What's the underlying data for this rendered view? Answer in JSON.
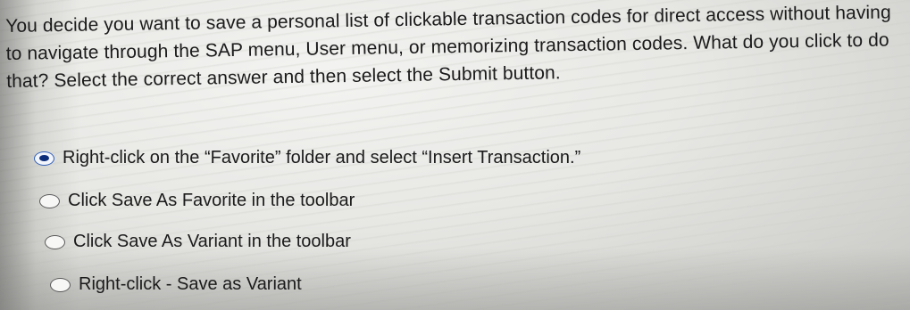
{
  "question": {
    "text": "You decide you want to save a personal list of clickable transaction codes for direct access without having to navigate through the SAP menu, User menu, or memorizing transaction codes. What do you click to do that? Select the correct answer and then select the Submit button."
  },
  "options": [
    {
      "label": "Right-click on the “Favorite” folder and select “Insert Transaction.”",
      "selected": true
    },
    {
      "label": "Click Save As Favorite in the toolbar",
      "selected": false
    },
    {
      "label": "Click Save As Variant in the toolbar",
      "selected": false
    },
    {
      "label": "Right-click - Save as Variant",
      "selected": false
    }
  ],
  "colors": {
    "selected_dot": "#0c2d7a",
    "selected_ring": "#2f5fb8",
    "text": "#1b1b1b"
  }
}
